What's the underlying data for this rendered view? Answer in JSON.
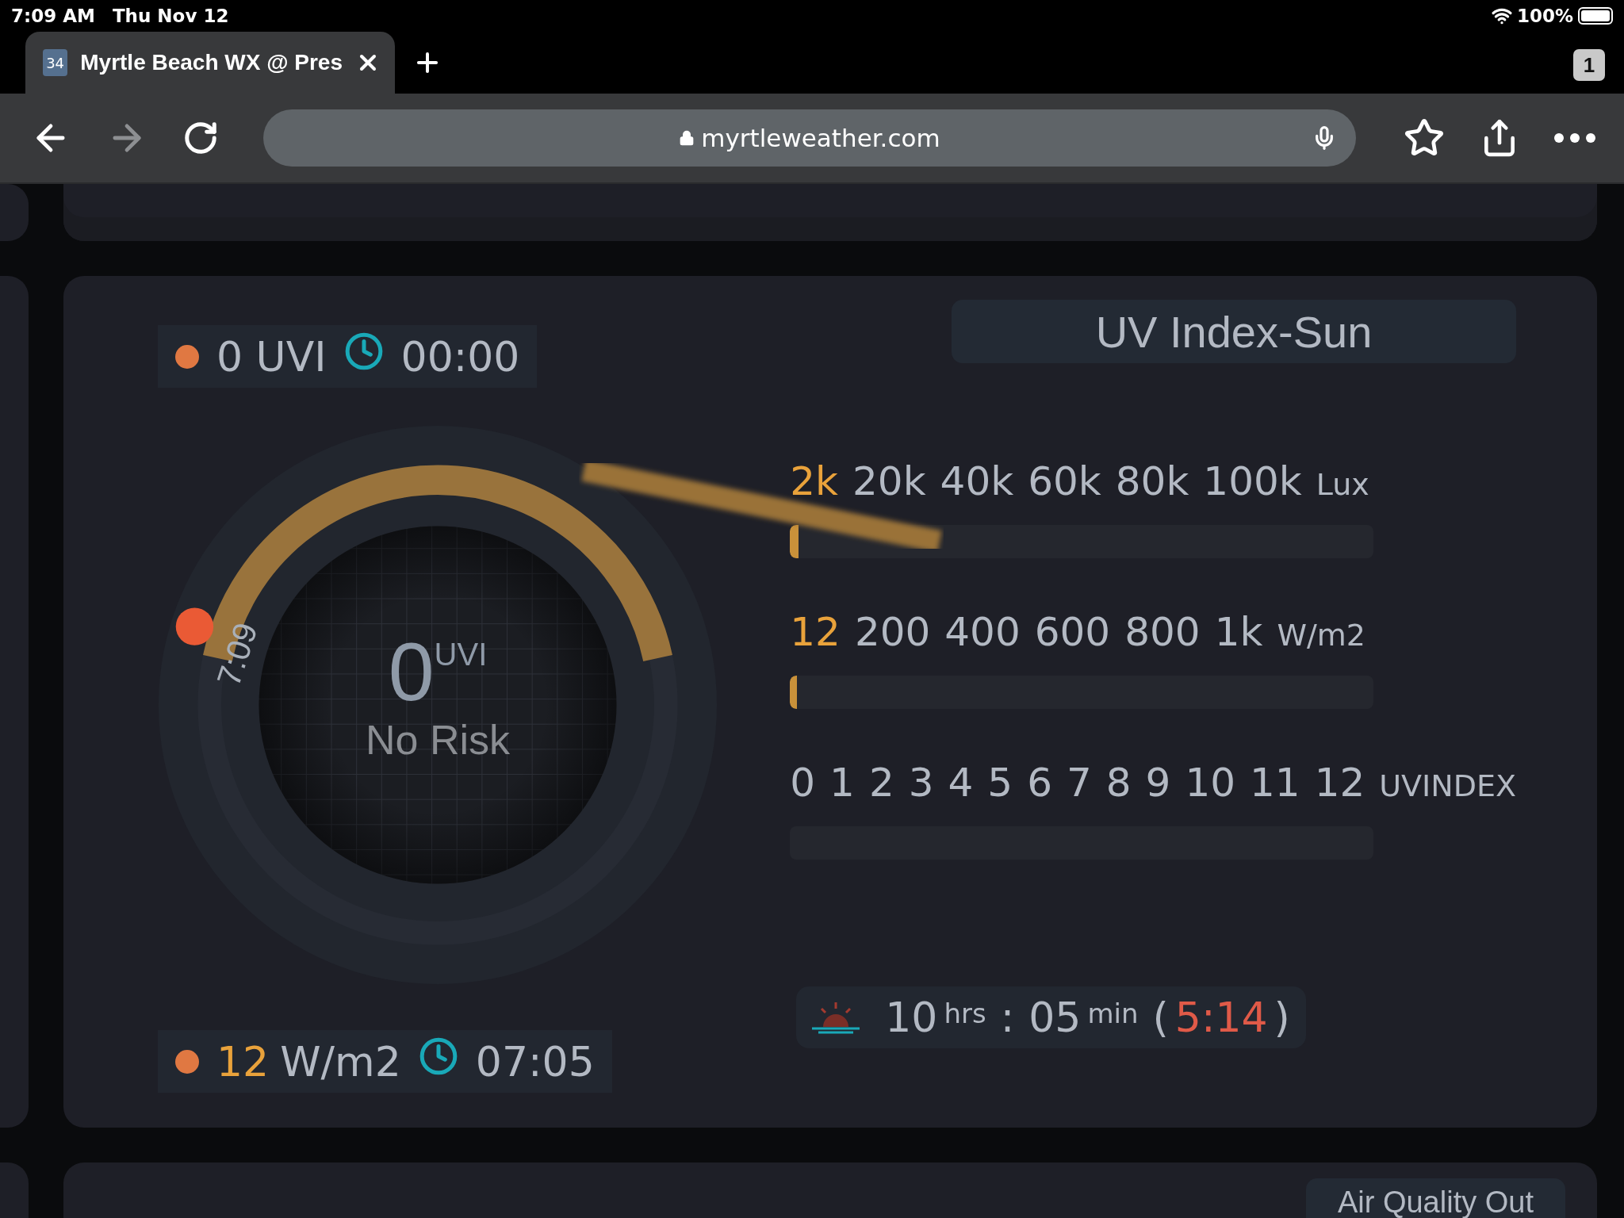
{
  "status_bar": {
    "time": "7:09 AM",
    "date": "Thu Nov 12",
    "battery": "100%"
  },
  "browser": {
    "tab": {
      "favicon": "34",
      "title": "Myrtle Beach WX @ Pres",
      "selected": true
    },
    "tab_count": "1",
    "back": {
      "disabled": false
    },
    "forward": {
      "disabled": true
    },
    "url": "myrtleweather.com"
  },
  "uv_card": {
    "title": "UV Index-Sun",
    "uv_reading": {
      "value": "0 UVI",
      "time": "00:00"
    },
    "gauge": {
      "value": "0",
      "unit": "UVI",
      "risk": "No Risk",
      "time_marker": "7:09"
    },
    "scales": [
      {
        "highlight": "2k",
        "ticks": [
          "20k",
          "40k",
          "60k",
          "80k",
          "100k"
        ],
        "unit": "Lux",
        "level": 0.015
      },
      {
        "highlight": "12",
        "ticks": [
          "200",
          "400",
          "600",
          "800",
          "1k"
        ],
        "unit": "W/m2",
        "level": 0.012
      },
      {
        "ticks": [
          "0",
          "1",
          "2",
          "3",
          "4",
          "5",
          "6",
          "7",
          "8",
          "9",
          "10",
          "11",
          "12"
        ],
        "unit": "UVINDEX",
        "level": 0
      }
    ],
    "solar_reading": {
      "value": "12",
      "unit": "W/m2",
      "time": "07:05"
    },
    "daylight": {
      "hours": "10",
      "hours_unit": "hrs",
      "separator": ":",
      "minutes": "05",
      "minutes_unit": "min",
      "paren_open": "(",
      "remaining": "5:14",
      "paren_close": ")"
    }
  },
  "next_card": {
    "title": "Air Quality Out"
  }
}
